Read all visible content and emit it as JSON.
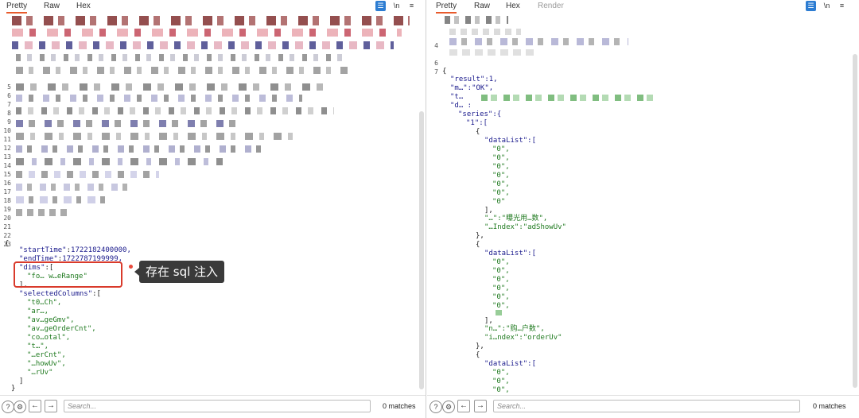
{
  "left": {
    "tabs": [
      "Pretty",
      "Raw",
      "Hex"
    ],
    "toolbar": {
      "wrap": "☰",
      "newline": "\\n",
      "menu": "≡"
    },
    "line_numbers": [
      "5",
      "6",
      "7",
      "8",
      "9",
      "10",
      "11",
      "12",
      "13",
      "14",
      "15",
      "16",
      "17",
      "18",
      "19",
      "20",
      "21",
      "22",
      "23"
    ],
    "body": {
      "open": "{",
      "start_key": "\"startTime\"",
      "start_val": "1722182400000,",
      "end_key": "\"endTime\"",
      "end_val": "1722787199999,",
      "dims_key": "\"dims\"",
      "dims_open": ":[",
      "dims_item": "\"fo… w…eRange\"",
      "close_arr": "],",
      "sel_key": "\"selectedColumns\"",
      "sel_open": ":[",
      "sel_items": [
        "\"t0…Ch\",",
        "\"ar…,",
        "\"av…geGmv\",",
        "\"av…geOrderCnt\",",
        "\"co…otal\",",
        "\"t…\",",
        "\"…erCnt\",",
        "\"…howUv\",",
        "\"…rUv\""
      ],
      "close_sel": "]",
      "close": "}"
    },
    "annotation": "存在 sql 注入",
    "footer": {
      "search_placeholder": "Search...",
      "matches": "0 matches"
    }
  },
  "right": {
    "tabs": [
      "Pretty",
      "Raw",
      "Hex",
      "Render"
    ],
    "toolbar": {
      "wrap": "☰",
      "newline": "\\n",
      "menu": "≡"
    },
    "line_numbers": [
      "4",
      "6",
      "7"
    ],
    "body": {
      "open": "{",
      "result": "\"result\":1,",
      "msg": "\"m…\":\"OK\",",
      "t_line": "\"t…",
      "d_line": "\"d… :",
      "series": "\"series\":{",
      "one": "\"1\":[",
      "obj_open": "{",
      "datalist": "\"dataList\":[",
      "zero": "\"0\",",
      "zero_last": "\"0\"",
      "arr_close": "],",
      "name1": "\"…\":\"曝光用…数\",",
      "idx1": "\"…Index\":\"adShowUv\"",
      "obj_close": "},",
      "name2": "\"n…\":\"购…户数\",",
      "idx2": "\"i…ndex\":\"orderUv\""
    },
    "footer": {
      "search_placeholder": "Search...",
      "matches": "0 matches"
    }
  },
  "footer_icons": {
    "help": "?",
    "settings": "⚙",
    "back": "←",
    "forward": "→"
  }
}
